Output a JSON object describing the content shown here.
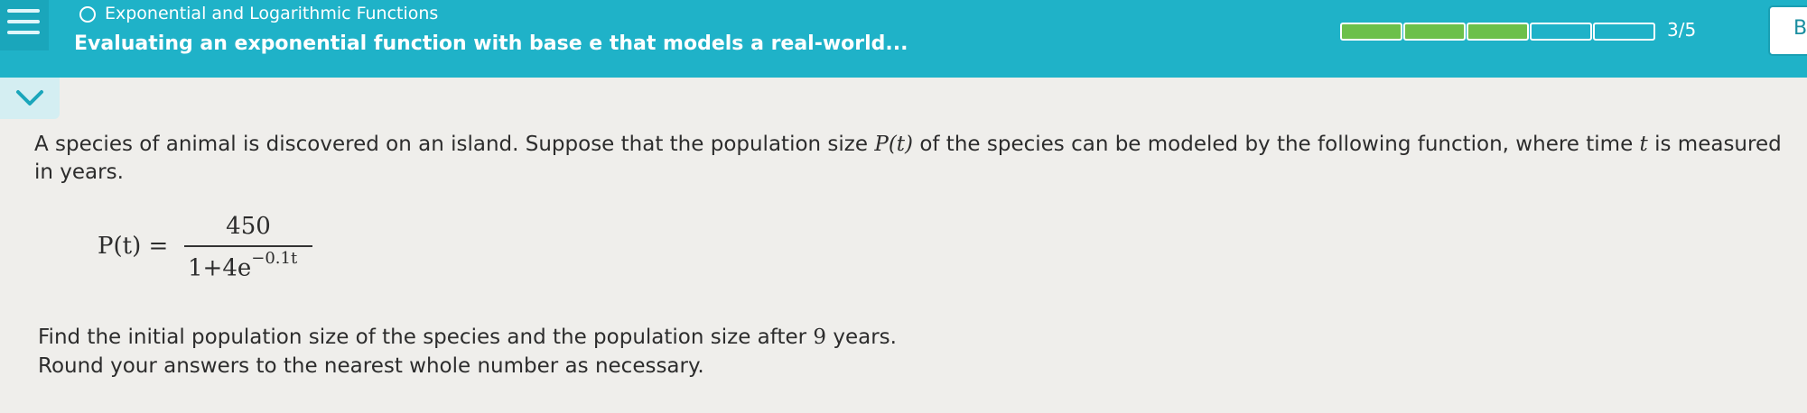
{
  "header": {
    "topic": "Exponential and Logarithmic Functions",
    "lesson_title": "Evaluating an exponential function with base e that models a real-world...",
    "progress": {
      "completed": 3,
      "total": 5,
      "label": "3/5"
    },
    "side_tab_label": "B"
  },
  "problem": {
    "intro_part1": "A species of animal is discovered on an island. Suppose that the population size ",
    "function_name": "P",
    "function_var": "(t)",
    "intro_part2": " of the species can be modeled by the following function, where time ",
    "time_var": "t",
    "intro_part3": " is measured in years.",
    "formula": {
      "lhs": "P(t) =",
      "numerator": "450",
      "denominator_base": "1+4e",
      "denominator_exponent": "−0.1t"
    },
    "question_part1": "Find the initial population size of the species and the population size after ",
    "question_years": "9",
    "question_part2": " years.",
    "round_instruction": "Round your answers to the nearest whole number as necessary."
  },
  "colors": {
    "header_bg": "#1fb2c8",
    "progress_filled": "#6cc04a",
    "page_bg": "#efeeeb"
  },
  "icons": {
    "menu": "hamburger-menu-icon",
    "topic": "circle-outline-icon",
    "collapse": "chevron-down-icon"
  }
}
